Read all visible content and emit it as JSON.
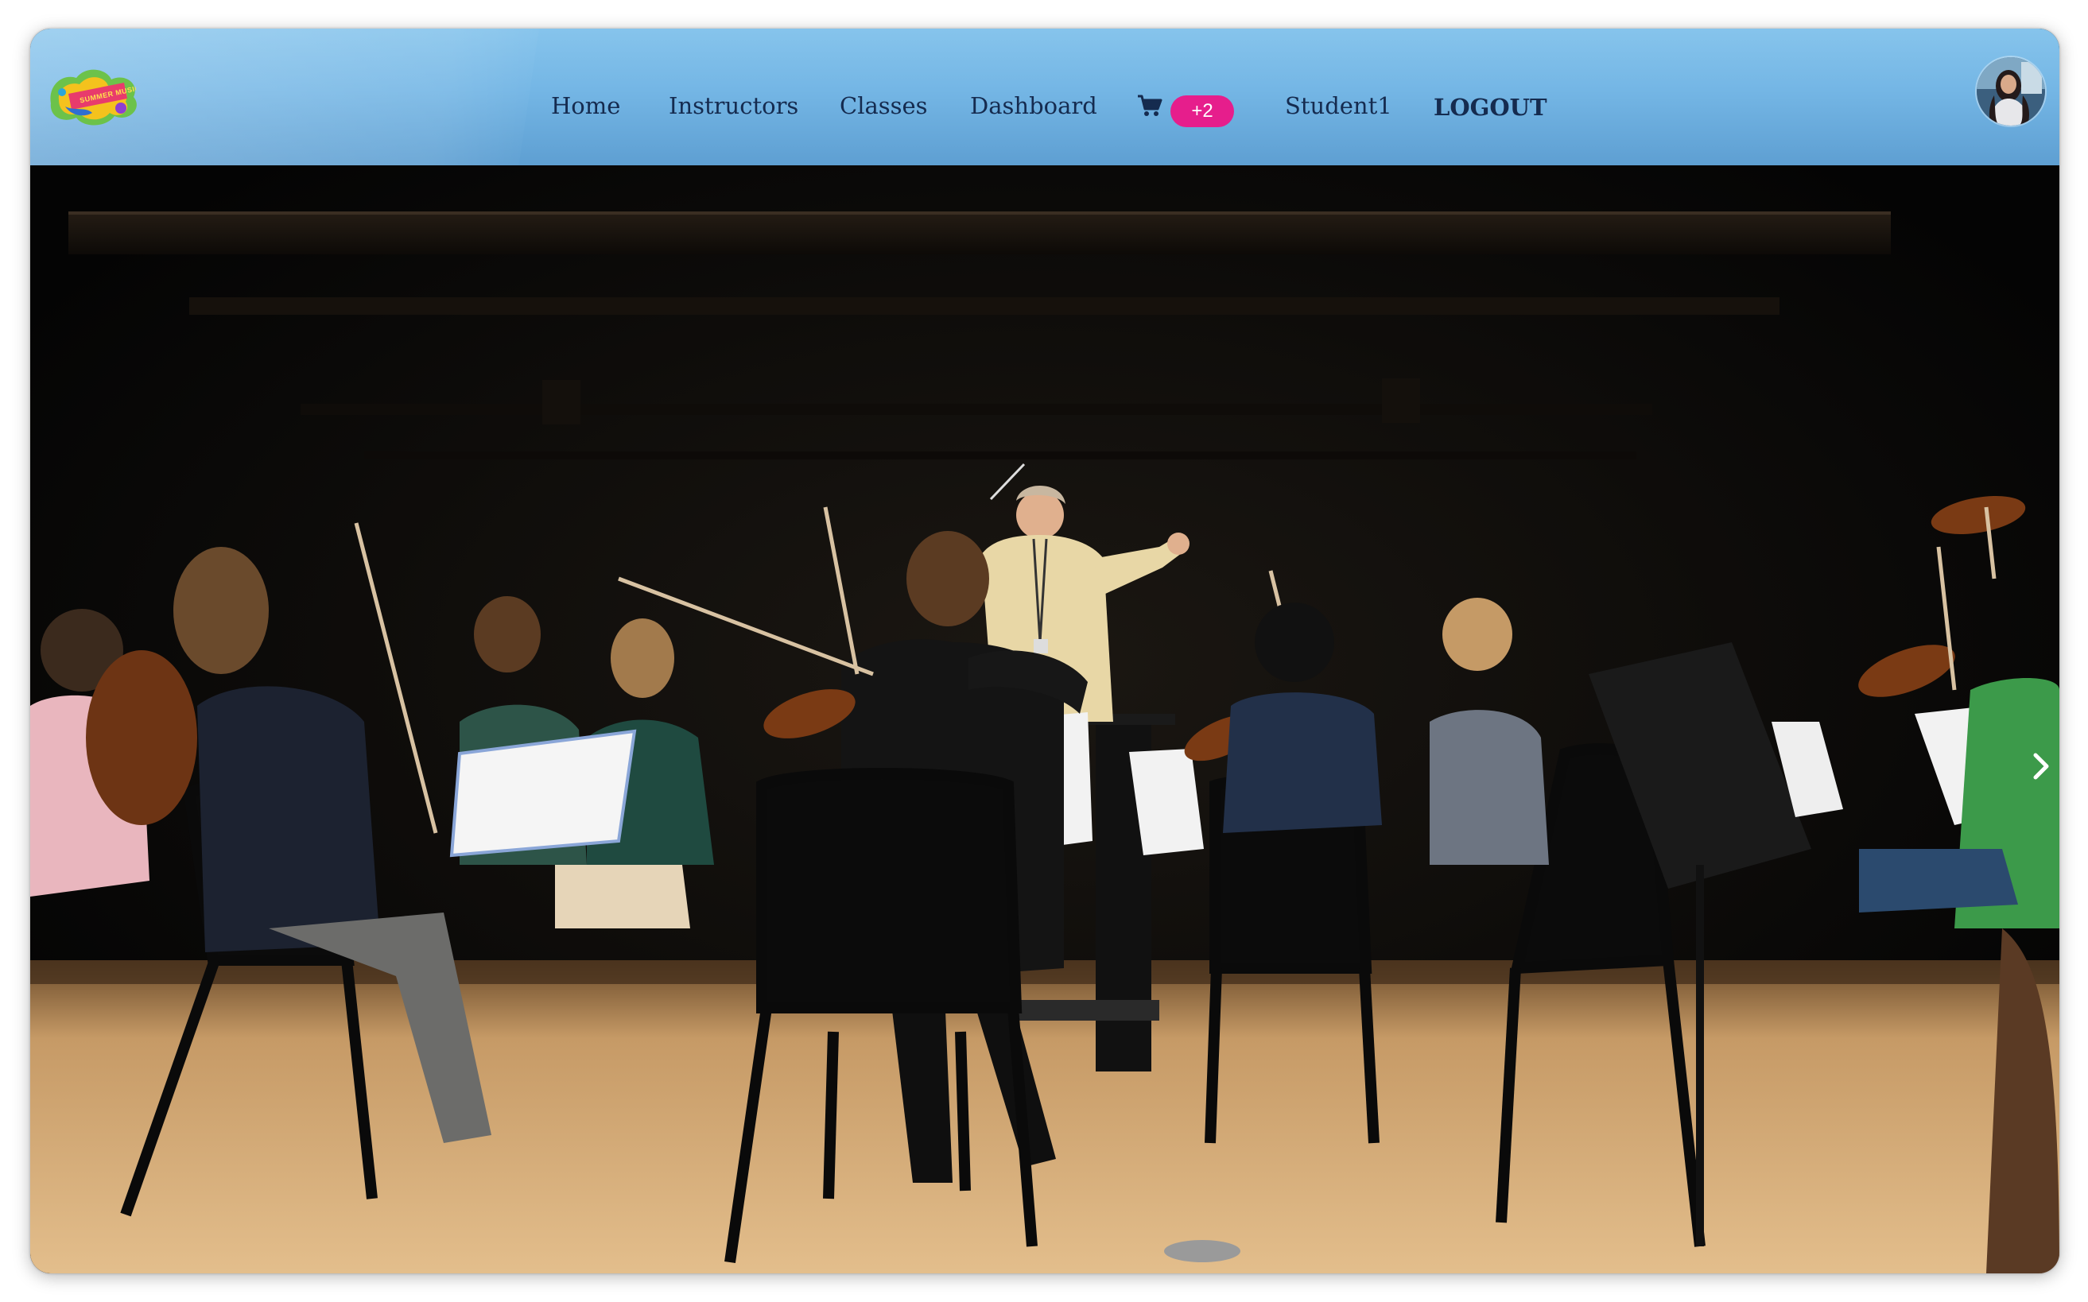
{
  "brand": {
    "logo_text": "SUMMER MUSIC CAMP",
    "colors": {
      "navbar_top": "#86c4ec",
      "navbar_bottom": "#5e9fd2",
      "link": "#152b4f",
      "badge": "#e61e8c"
    }
  },
  "nav": {
    "items": [
      {
        "label": "Home"
      },
      {
        "label": "Instructors"
      },
      {
        "label": "Classes"
      },
      {
        "label": "Dashboard"
      }
    ],
    "cart": {
      "icon": "shopping-cart-icon",
      "badge": "+2"
    },
    "user": "Student1",
    "logout": "LOGOUT",
    "avatar_icon": "user-avatar"
  },
  "hero": {
    "image": "orchestra-rehearsal-photo",
    "next_icon": "chevron-right-icon"
  }
}
